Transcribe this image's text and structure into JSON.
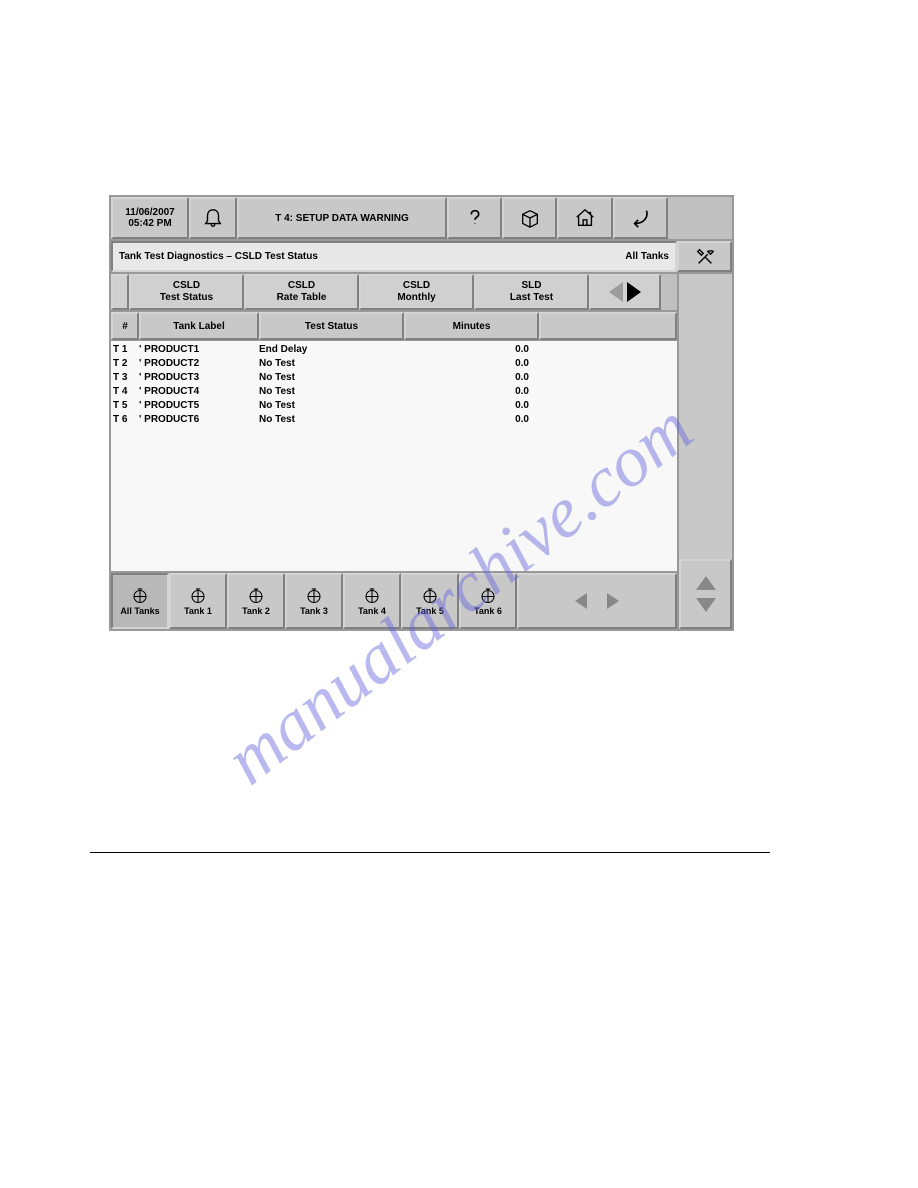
{
  "toolbar": {
    "date": "11/06/2007",
    "time": "05:42 PM",
    "title": "T 4: SETUP DATA WARNING"
  },
  "breadcrumb": {
    "path": "Tank Test Diagnostics – CSLD Test Status",
    "filter": "All Tanks"
  },
  "tabs": {
    "t1": "CSLD\nTest Status",
    "t2": "CSLD\nRate Table",
    "t3": "CSLD\nMonthly",
    "t4": "SLD\nLast Test"
  },
  "columns": {
    "num": "#",
    "label": "Tank Label",
    "status": "Test Status",
    "minutes": "Minutes"
  },
  "rows": [
    {
      "num": "T 1",
      "label": "' PRODUCT1",
      "status": "End Delay",
      "minutes": "0.0"
    },
    {
      "num": "T 2",
      "label": "' PRODUCT2",
      "status": "No Test",
      "minutes": "0.0"
    },
    {
      "num": "T 3",
      "label": "' PRODUCT3",
      "status": "No Test",
      "minutes": "0.0"
    },
    {
      "num": "T 4",
      "label": "' PRODUCT4",
      "status": "No Test",
      "minutes": "0.0"
    },
    {
      "num": "T 5",
      "label": "' PRODUCT5",
      "status": "No Test",
      "minutes": "0.0"
    },
    {
      "num": "T 6",
      "label": "' PRODUCT6",
      "status": "No Test",
      "minutes": "0.0"
    }
  ],
  "bottom": {
    "all": "All Tanks",
    "t1": "Tank 1",
    "t2": "Tank 2",
    "t3": "Tank 3",
    "t4": "Tank 4",
    "t5": "Tank 5",
    "t6": "Tank 6"
  },
  "watermark": "manualarchive.com"
}
